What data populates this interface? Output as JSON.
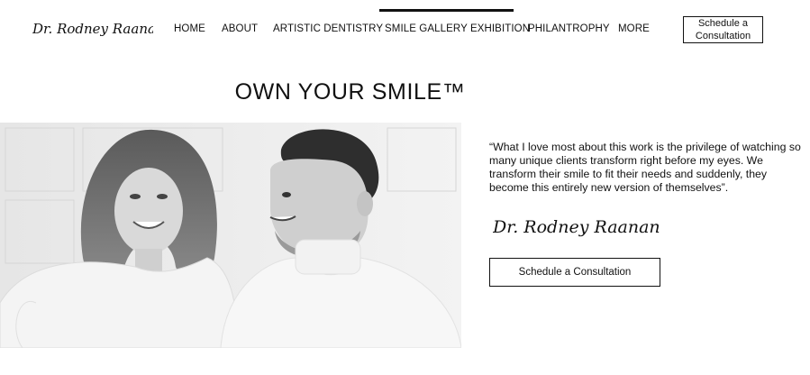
{
  "brand": {
    "logo_text": "Dr. Rodney Raanan"
  },
  "nav": {
    "items": [
      {
        "label": "HOME"
      },
      {
        "label": "ABOUT"
      },
      {
        "label": "ARTISTIC DENTISTRY"
      },
      {
        "label": "SMILE GALLERY EXHIBITION",
        "active": true
      },
      {
        "label": "PHILANTROPHY"
      },
      {
        "label": "MORE"
      }
    ],
    "cta_label": "Schedule a Consultation"
  },
  "hero": {
    "headline": "OWN YOUR SMILE™",
    "quote": "“What I love most about this work is the privilege of watching so many unique clients transform right before my eyes. We transform their smile to fit their needs and suddenly, they become this entirely new version of themselves”.",
    "signature_text": "Dr. Rodney Raanan",
    "cta_label": "Schedule a Consultation"
  },
  "colors": {
    "text": "#111111",
    "background": "#ffffff",
    "photo_bg": "#e9e9e9"
  }
}
